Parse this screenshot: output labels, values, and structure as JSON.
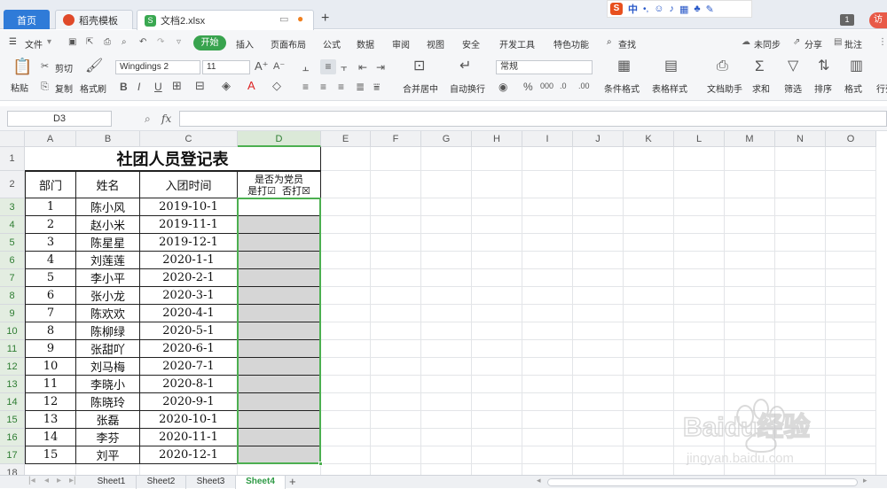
{
  "titlebar": {
    "tabs": [
      {
        "label": "首页"
      },
      {
        "label": "稻壳模板"
      },
      {
        "label": "文档2.xlsx"
      }
    ],
    "new_tab": "+",
    "ime_label": "中",
    "window_num": "1"
  },
  "menu": {
    "file": "文件",
    "items": [
      "开始",
      "插入",
      "页面布局",
      "公式",
      "数据",
      "审阅",
      "视图",
      "安全",
      "开发工具",
      "特色功能"
    ],
    "search": "查找",
    "unsync": "未同步",
    "share": "分享",
    "comment": "批注"
  },
  "ribbon": {
    "paste": "粘贴",
    "cut": "剪切",
    "copy": "复制",
    "format_painter": "格式刷",
    "font_name": "Wingdings 2",
    "font_size": "11",
    "merge": "合并居中",
    "wrap": "自动换行",
    "number_format": "常规",
    "cond_format": "条件格式",
    "table_style": "表格样式",
    "doc_helper": "文档助手",
    "sum": "求和",
    "filter": "筛选",
    "sort": "排序",
    "format": "格式",
    "rows_cols": "行列"
  },
  "formula_bar": {
    "name_box": "D3",
    "fx": "fx",
    "value": ""
  },
  "columns": [
    "A",
    "B",
    "C",
    "D",
    "E",
    "F",
    "G",
    "H",
    "I",
    "J",
    "K",
    "L",
    "M",
    "N",
    "O"
  ],
  "rows": [
    "1",
    "2",
    "3",
    "4",
    "5",
    "6",
    "7",
    "8",
    "9",
    "10",
    "11",
    "12",
    "13",
    "14",
    "15",
    "16",
    "17",
    "18"
  ],
  "sheet": {
    "title": "社团人员登记表",
    "headers": {
      "dept": "部门",
      "name": "姓名",
      "join_date": "入团时间",
      "party_title": "是否为党员",
      "party_options": "是打☑  否打☒"
    },
    "records": [
      {
        "dept": "1",
        "name": "陈小风",
        "date": "2019-10-1"
      },
      {
        "dept": "2",
        "name": "赵小米",
        "date": "2019-11-1"
      },
      {
        "dept": "3",
        "name": "陈星星",
        "date": "2019-12-1"
      },
      {
        "dept": "4",
        "name": "刘莲莲",
        "date": "2020-1-1"
      },
      {
        "dept": "5",
        "name": "李小平",
        "date": "2020-2-1"
      },
      {
        "dept": "6",
        "name": "张小龙",
        "date": "2020-3-1"
      },
      {
        "dept": "7",
        "name": "陈欢欢",
        "date": "2020-4-1"
      },
      {
        "dept": "8",
        "name": "陈柳绿",
        "date": "2020-5-1"
      },
      {
        "dept": "9",
        "name": "张甜吖",
        "date": "2020-6-1"
      },
      {
        "dept": "10",
        "name": "刘马梅",
        "date": "2020-7-1"
      },
      {
        "dept": "11",
        "name": "李晓小",
        "date": "2020-8-1"
      },
      {
        "dept": "12",
        "name": "陈晓玲",
        "date": "2020-9-1"
      },
      {
        "dept": "13",
        "name": "张磊",
        "date": "2020-10-1"
      },
      {
        "dept": "14",
        "name": "李芬",
        "date": "2020-11-1"
      },
      {
        "dept": "15",
        "name": "刘平",
        "date": "2020-12-1"
      }
    ]
  },
  "sheet_tabs": [
    "Sheet1",
    "Sheet2",
    "Sheet3",
    "Sheet4"
  ],
  "active_sheet": "Sheet4",
  "watermark": {
    "brand": "Baidu经验",
    "url": "jingyan.baidu.com"
  },
  "colors": {
    "accent_green": "#38a34e",
    "tab_blue": "#2f7bd8",
    "selection": "#4caf50"
  }
}
